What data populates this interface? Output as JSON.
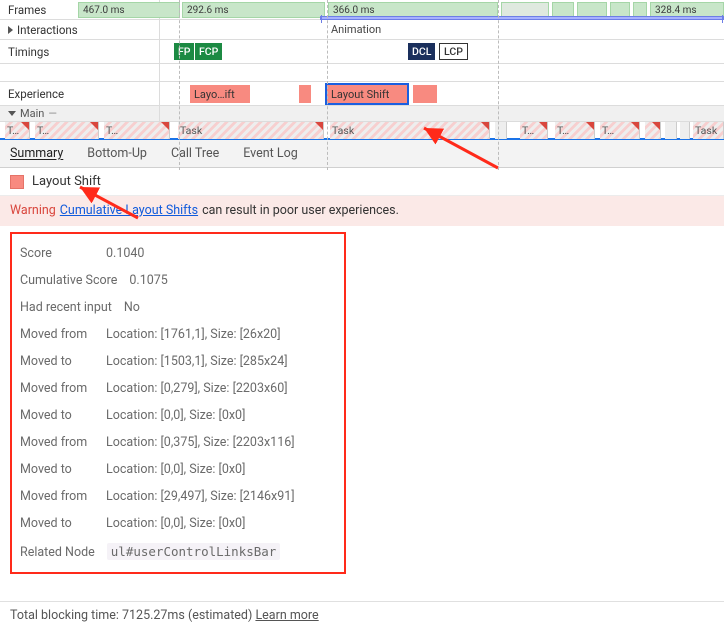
{
  "tracks": {
    "frames_label": "Frames",
    "interactions_label": "Interactions",
    "timings_label": "Timings",
    "experience_label": "Experience",
    "main_label": "Main",
    "main_suffix": "—",
    "animation_label": "Animation",
    "frames": [
      {
        "label": "467.0 ms"
      },
      {
        "label": "292.6 ms"
      },
      {
        "label": "366.0 ms"
      },
      {
        "label": "328.4 ms"
      }
    ],
    "timings": {
      "fp": "FP",
      "fcp": "FCP",
      "dcl": "DCL",
      "lcp": "LCP"
    },
    "experience": {
      "ls_short": "Layo…ift",
      "ls_full": "Layout Shift"
    },
    "tasks": [
      {
        "label": "T…"
      },
      {
        "label": "T…"
      },
      {
        "label": "T…"
      },
      {
        "label": "Task"
      },
      {
        "label": "Task"
      },
      {
        "label": "T…"
      },
      {
        "label": "T…"
      },
      {
        "label": "T…"
      },
      {
        "label": "Task"
      }
    ]
  },
  "tabs": {
    "summary": "Summary",
    "bottom_up": "Bottom-Up",
    "call_tree": "Call Tree",
    "event_log": "Event Log"
  },
  "panel": {
    "title": "Layout Shift"
  },
  "warning": {
    "prefix": "Warning",
    "link": "Cumulative Layout Shifts",
    "rest": "can result in poor user experiences."
  },
  "details": {
    "score_k": "Score",
    "score_v": "0.1040",
    "cum_k": "Cumulative Score",
    "cum_v": "0.1075",
    "recent_k": "Had recent input",
    "recent_v": "No",
    "rows": [
      {
        "k": "Moved from",
        "v": "Location: [1761,1], Size: [26x20]"
      },
      {
        "k": "Moved to",
        "v": "Location: [1503,1], Size: [285x24]"
      },
      {
        "k": "Moved from",
        "v": "Location: [0,279], Size: [2203x60]"
      },
      {
        "k": "Moved to",
        "v": "Location: [0,0], Size: [0x0]"
      },
      {
        "k": "Moved from",
        "v": "Location: [0,375], Size: [2203x116]"
      },
      {
        "k": "Moved to",
        "v": "Location: [0,0], Size: [0x0]"
      },
      {
        "k": "Moved from",
        "v": "Location: [29,497], Size: [2146x91]"
      },
      {
        "k": "Moved to",
        "v": "Location: [0,0], Size: [0x0]"
      }
    ],
    "related_k": "Related Node",
    "related_v": "ul#userControlLinksBar"
  },
  "footer": {
    "text": "Total blocking time: 7125.27ms (estimated)",
    "link": "Learn more"
  }
}
